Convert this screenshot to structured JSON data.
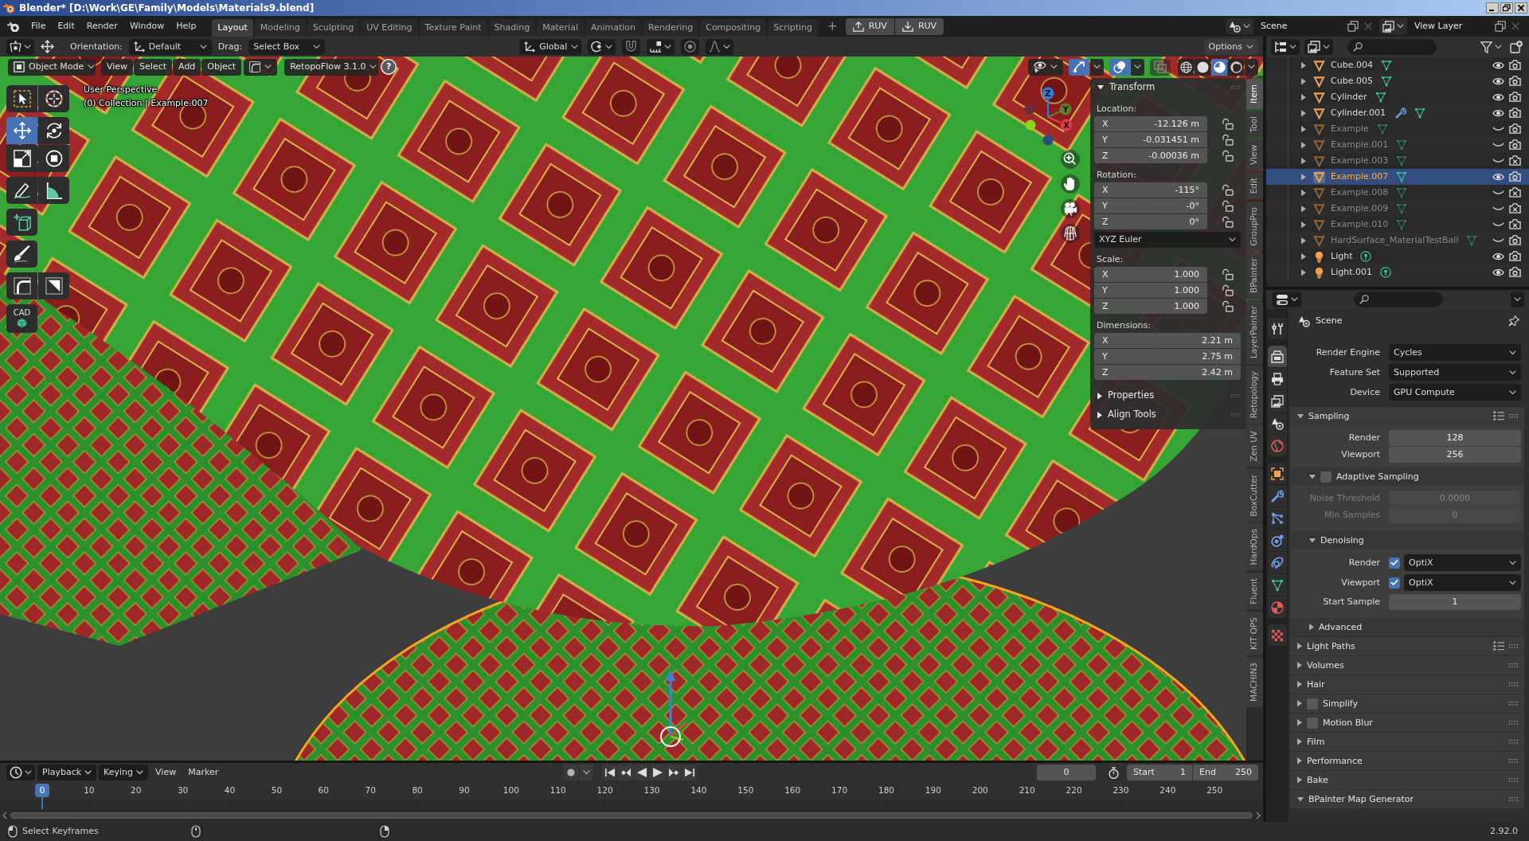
{
  "window": {
    "title": "Blender* [D:\\Work\\GE\\Family\\Models\\Materials9.blend]"
  },
  "top_bar": {
    "menus": [
      "File",
      "Edit",
      "Render",
      "Window",
      "Help"
    ],
    "workspaces": [
      {
        "label": "Layout",
        "selected": true
      },
      {
        "label": "Modeling",
        "selected": false
      },
      {
        "label": "Sculpting",
        "selected": false
      },
      {
        "label": "UV Editing",
        "selected": false
      },
      {
        "label": "Texture Paint",
        "selected": false
      },
      {
        "label": "Shading",
        "selected": false
      },
      {
        "label": "Material",
        "selected": false
      },
      {
        "label": "Animation",
        "selected": false
      },
      {
        "label": "Rendering",
        "selected": false
      },
      {
        "label": "Compositing",
        "selected": false
      },
      {
        "label": "Scripting",
        "selected": false
      }
    ],
    "add_workspace": "+",
    "addon_buttons": [
      {
        "kind": "upload",
        "label": "RUV"
      },
      {
        "kind": "download",
        "label": "RUV"
      }
    ],
    "scene": "Scene",
    "view_layer": "View Layer"
  },
  "tool_header": {
    "orientation_label": "Orientation:",
    "orientation": "Default",
    "drag_label": "Drag:",
    "drag": "Select Box",
    "transform_orientation": "Global",
    "snap": false,
    "proportional_editing": false,
    "options": "Options"
  },
  "viewport": {
    "mode": "Object Mode",
    "menus": [
      "View",
      "Select",
      "Add",
      "Object"
    ],
    "addon_menu": "RetopoFlow 3.1.0",
    "help": "?",
    "info": [
      "User Perspective",
      "(0) Collection | Example.007"
    ],
    "tool_groups": [
      [
        {
          "kind": "select_box",
          "selected": false
        },
        {
          "kind": "cursor",
          "selected": false
        }
      ],
      [
        {
          "kind": "move",
          "selected": true
        },
        {
          "kind": "rotate",
          "selected": false
        },
        {
          "kind": "scale",
          "selected": false
        },
        {
          "kind": "transform",
          "selected": false
        }
      ],
      [
        {
          "kind": "annotate",
          "selected": false
        },
        {
          "kind": "measure",
          "selected": false
        }
      ],
      [
        {
          "kind": "add_cube",
          "selected": false
        }
      ],
      [
        {
          "kind": "brush",
          "selected": false
        }
      ],
      [
        {
          "kind": "corner",
          "selected": false
        },
        {
          "kind": "slice",
          "selected": false
        }
      ],
      [
        {
          "kind": "cad",
          "label": "CAD",
          "selected": false
        }
      ]
    ],
    "toggles": [
      {
        "kind": "gizmo",
        "on": true
      },
      {
        "kind": "overlays",
        "on": true
      },
      {
        "kind": "xray",
        "on": false
      }
    ],
    "shading": [
      {
        "kind": "wireframe",
        "selected": false
      },
      {
        "kind": "solid",
        "selected": false
      },
      {
        "kind": "material",
        "selected": true
      },
      {
        "kind": "rendered",
        "selected": false
      }
    ],
    "axes": [
      {
        "label": "X",
        "color": "#e8344a"
      },
      {
        "label": "Y",
        "color": "#5f7d2a"
      },
      {
        "label": "Z",
        "color": "#2e7de0"
      }
    ],
    "negative_axes": [
      {
        "color": "#6e2c3a"
      },
      {
        "color": "#8fd21e"
      },
      {
        "color": "#2a4a80"
      }
    ]
  },
  "sidebar": {
    "tabs": [
      {
        "label": "Item",
        "selected": true
      },
      {
        "label": "Tool",
        "selected": false
      },
      {
        "label": "View",
        "selected": false
      },
      {
        "label": "Edit",
        "selected": false
      },
      {
        "label": "GroupPro",
        "selected": false
      },
      {
        "label": "BPainter",
        "selected": false
      },
      {
        "label": "LayerPainter",
        "selected": false
      },
      {
        "label": "Retopology",
        "selected": false
      },
      {
        "label": "Zen UV",
        "selected": false
      },
      {
        "label": "BoxCutter",
        "selected": false
      },
      {
        "label": "HardOps",
        "selected": false
      },
      {
        "label": "Fluent",
        "selected": false
      },
      {
        "label": "KIT OPS",
        "selected": false
      },
      {
        "label": "MACHIN3",
        "selected": false
      }
    ],
    "panels": [
      {
        "title": "Transform",
        "expanded": true,
        "groups": [
          {
            "label": "Location:",
            "fields": [
              {
                "axis": "X",
                "value": "-12.126 m",
                "locked": false
              },
              {
                "axis": "Y",
                "value": "-0.031451 m",
                "locked": false
              },
              {
                "axis": "Z",
                "value": "-0.00036 m",
                "locked": false
              }
            ]
          },
          {
            "label": "Rotation:",
            "fields": [
              {
                "axis": "X",
                "value": "-115°",
                "locked": false
              },
              {
                "axis": "Y",
                "value": "-0°",
                "locked": false
              },
              {
                "axis": "Z",
                "value": "0°",
                "locked": false
              }
            ],
            "mode": "XYZ Euler"
          },
          {
            "label": "Scale:",
            "fields": [
              {
                "axis": "X",
                "value": "1.000",
                "locked": false
              },
              {
                "axis": "Y",
                "value": "1.000",
                "locked": false
              },
              {
                "axis": "Z",
                "value": "1.000",
                "locked": false
              }
            ]
          },
          {
            "label": "Dimensions:",
            "fields": [
              {
                "axis": "X",
                "value": "2.21 m"
              },
              {
                "axis": "Y",
                "value": "2.75 m"
              },
              {
                "axis": "Z",
                "value": "2.42 m"
              }
            ]
          }
        ]
      },
      {
        "title": "Properties",
        "expanded": false
      },
      {
        "title": "Align Tools",
        "expanded": false
      }
    ]
  },
  "outliner": {
    "items": [
      {
        "name": "Cube.004",
        "kind": "mesh",
        "expanded": false,
        "modifier": false,
        "visible": true,
        "renderable": true,
        "selected": false
      },
      {
        "name": "Cube.005",
        "kind": "mesh",
        "expanded": false,
        "modifier": false,
        "visible": true,
        "renderable": true,
        "selected": false
      },
      {
        "name": "Cylinder",
        "kind": "mesh",
        "expanded": false,
        "modifier": false,
        "visible": true,
        "renderable": true,
        "selected": false
      },
      {
        "name": "Cylinder.001",
        "kind": "mesh",
        "expanded": false,
        "modifier": true,
        "visible": true,
        "renderable": true,
        "selected": false
      },
      {
        "name": "Example",
        "kind": "mesh",
        "expanded": false,
        "modifier": false,
        "visible": false,
        "renderable": true,
        "selected": false
      },
      {
        "name": "Example.001",
        "kind": "mesh",
        "expanded": false,
        "modifier": false,
        "visible": false,
        "renderable": true,
        "selected": false
      },
      {
        "name": "Example.003",
        "kind": "mesh",
        "expanded": false,
        "modifier": false,
        "visible": false,
        "renderable": false,
        "selected": false
      },
      {
        "name": "Example.007",
        "kind": "mesh",
        "expanded": false,
        "modifier": false,
        "visible": true,
        "renderable": true,
        "selected": true
      },
      {
        "name": "Example.008",
        "kind": "mesh",
        "expanded": false,
        "modifier": false,
        "visible": false,
        "renderable": false,
        "selected": false
      },
      {
        "name": "Example.009",
        "kind": "mesh",
        "expanded": false,
        "modifier": false,
        "visible": false,
        "renderable": false,
        "selected": false
      },
      {
        "name": "Example.010",
        "kind": "mesh",
        "expanded": false,
        "modifier": false,
        "visible": false,
        "renderable": false,
        "selected": false
      },
      {
        "name": "HardSurface_MaterialTestBall",
        "kind": "mesh",
        "expanded": false,
        "modifier": false,
        "visible": false,
        "renderable": true,
        "selected": false
      },
      {
        "name": "Light",
        "kind": "light",
        "expanded": false,
        "modifier": false,
        "visible": true,
        "renderable": true,
        "selected": false
      },
      {
        "name": "Light.001",
        "kind": "light",
        "expanded": false,
        "modifier": false,
        "visible": true,
        "renderable": true,
        "selected": false
      }
    ]
  },
  "properties": {
    "tab_groups": [
      [
        {
          "kind": "tool",
          "selected": false
        }
      ],
      [
        {
          "kind": "render",
          "selected": true
        },
        {
          "kind": "output",
          "selected": false
        },
        {
          "kind": "view_layer",
          "selected": false
        },
        {
          "kind": "scene",
          "selected": false
        },
        {
          "kind": "world",
          "selected": false
        }
      ],
      [
        {
          "kind": "object",
          "selected": false
        },
        {
          "kind": "modifiers",
          "selected": false
        },
        {
          "kind": "particles",
          "selected": false
        },
        {
          "kind": "physics",
          "selected": false
        },
        {
          "kind": "constraints",
          "selected": false
        },
        {
          "kind": "data",
          "selected": false
        },
        {
          "kind": "material",
          "selected": false
        }
      ],
      [
        {
          "kind": "texture",
          "selected": false
        }
      ]
    ],
    "context": "Scene",
    "rows": [
      {
        "kind": "menu",
        "label": "Render Engine",
        "value": "Cycles"
      },
      {
        "kind": "menu",
        "label": "Feature Set",
        "value": "Supported"
      },
      {
        "kind": "menu",
        "label": "Device",
        "value": "GPU Compute"
      }
    ],
    "panels": [
      {
        "title": "Sampling",
        "expanded": true,
        "presets": true,
        "rows": [
          {
            "kind": "number",
            "label": "Render",
            "value": "128",
            "disabled": false
          },
          {
            "kind": "number",
            "label": "Viewport",
            "value": "256",
            "disabled": false
          }
        ],
        "subpanels": [
          {
            "title": "Adaptive Sampling",
            "expanded": true,
            "checked": false,
            "rows": [
              {
                "kind": "number",
                "label": "Noise Threshold",
                "value": "0.0000",
                "disabled": true
              },
              {
                "kind": "number",
                "label": "Min Samples",
                "value": "0",
                "disabled": true
              }
            ]
          },
          {
            "title": "Denoising",
            "expanded": true,
            "rows": [
              {
                "kind": "check_menu",
                "label": "Render",
                "checked": true,
                "value": "OptiX"
              },
              {
                "kind": "check_menu",
                "label": "Viewport",
                "checked": true,
                "value": "OptiX"
              },
              {
                "kind": "number",
                "label": "Start Sample",
                "value": "1",
                "disabled": false
              }
            ]
          },
          {
            "title": "Advanced",
            "expanded": false
          }
        ]
      },
      {
        "title": "Light Paths",
        "expanded": false,
        "presets": true
      },
      {
        "title": "Volumes",
        "expanded": false,
        "presets": false
      },
      {
        "title": "Hair",
        "expanded": false,
        "presets": false
      },
      {
        "title": "Simplify",
        "expanded": false,
        "presets": false,
        "checked": false
      },
      {
        "title": "Motion Blur",
        "expanded": false,
        "presets": false,
        "checked": false
      },
      {
        "title": "Film",
        "expanded": false,
        "presets": false
      },
      {
        "title": "Performance",
        "expanded": false,
        "presets": false
      },
      {
        "title": "Bake",
        "expanded": false,
        "presets": false
      },
      {
        "title": "BPainter Map Generator",
        "expanded": true,
        "presets": false
      }
    ]
  },
  "timeline": {
    "menus": [
      {
        "label": "Playback",
        "dropdown": true
      },
      {
        "label": "Keying",
        "dropdown": true
      },
      {
        "label": "View",
        "dropdown": false
      },
      {
        "label": "Marker",
        "dropdown": false
      }
    ],
    "auto_keying": false,
    "current_frame": "0",
    "start_label": "Start",
    "start": "1",
    "end_label": "End",
    "end": "250",
    "playhead": "0",
    "ticks": [
      "10",
      "20",
      "30",
      "40",
      "50",
      "60",
      "70",
      "80",
      "90",
      "100",
      "110",
      "120",
      "130",
      "140",
      "150",
      "160",
      "170",
      "180",
      "190",
      "200",
      "210",
      "220",
      "230",
      "240",
      "250"
    ]
  },
  "status_bar": {
    "hint": "Select Keyframes",
    "version": "2.92.0"
  }
}
